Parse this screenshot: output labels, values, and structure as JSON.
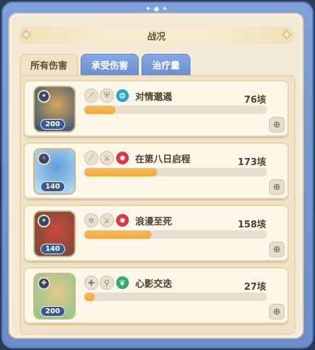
{
  "title": "战况",
  "tabs": [
    {
      "label": "所有伤害",
      "active": true
    },
    {
      "label": "承受伤害",
      "active": false
    },
    {
      "label": "治疗量",
      "active": false
    }
  ],
  "entries": [
    {
      "name": "对情邈遏",
      "value": "76垓",
      "level": "200",
      "fill_fraction": 0.17,
      "element_color": "#2aa6c8",
      "portrait_colors": [
        "#2c4a80",
        "#d7a858"
      ]
    },
    {
      "name": "在第八日启程",
      "value": "173垓",
      "level": "140",
      "fill_fraction": 0.4,
      "element_color": "#d8384a",
      "portrait_colors": [
        "#bfe3f5",
        "#5f9ed8"
      ]
    },
    {
      "name": "浪漫至死",
      "value": "158垓",
      "level": "140",
      "fill_fraction": 0.37,
      "element_color": "#d8384a",
      "portrait_colors": [
        "#6b4a3a",
        "#c94a3c"
      ]
    },
    {
      "name": "心影交迭",
      "value": "27垓",
      "level": "200",
      "fill_fraction": 0.06,
      "element_color": "#3aa86a",
      "portrait_colors": [
        "#7fc98a",
        "#e6c88a"
      ]
    }
  ],
  "colors": {
    "bar": "#f0ab45",
    "tab_inactive": "#7898d6",
    "panel": "#f3ead8"
  },
  "icons": [
    "path-icon",
    "shield-icon",
    "sword-icon",
    "element-icon",
    "zoom-in-icon"
  ]
}
